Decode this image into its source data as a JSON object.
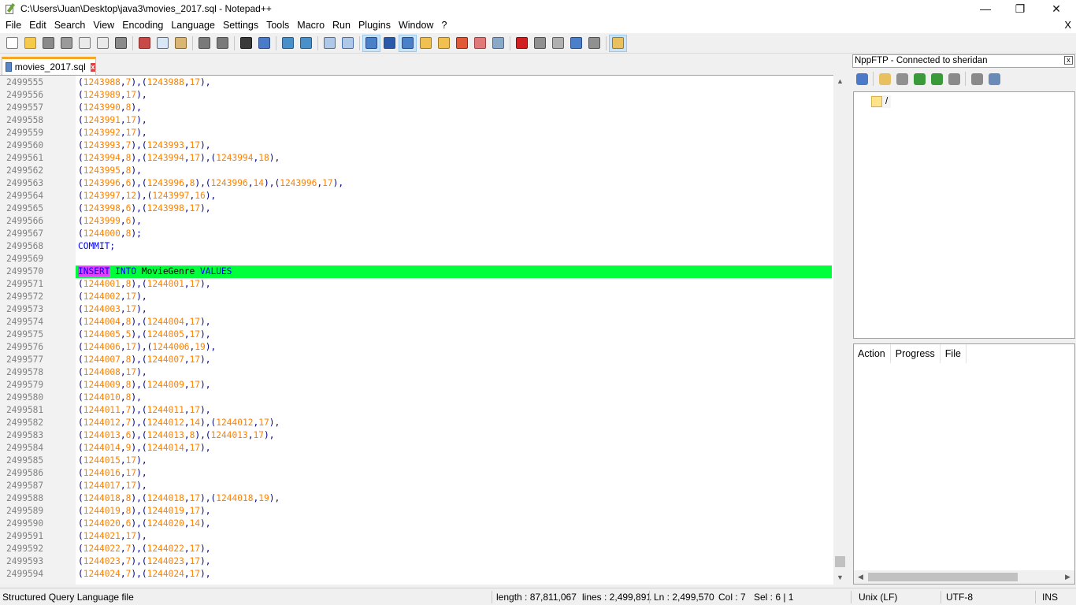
{
  "window": {
    "title": "C:\\Users\\Juan\\Desktop\\java3\\movies_2017.sql - Notepad++",
    "minimize": "—",
    "maximize": "❐",
    "close": "✕"
  },
  "menu": {
    "items": [
      "File",
      "Edit",
      "Search",
      "View",
      "Encoding",
      "Language",
      "Settings",
      "Tools",
      "Macro",
      "Run",
      "Plugins",
      "Window",
      "?"
    ],
    "close_doc": "X"
  },
  "toolbar": {
    "buttons": [
      {
        "name": "new-file-icon",
        "color": "#ffffff",
        "border": "#7a7a7a"
      },
      {
        "name": "open-file-icon",
        "color": "#f6c94a",
        "border": "#b98b1a"
      },
      {
        "name": "save-icon",
        "color": "#8a8a8a",
        "border": "#555555"
      },
      {
        "name": "save-all-icon",
        "color": "#9a9a9a",
        "border": "#555555"
      },
      {
        "name": "close-icon",
        "color": "#eaeaea",
        "border": "#7a7a7a"
      },
      {
        "name": "close-all-icon",
        "color": "#eaeaea",
        "border": "#7a7a7a"
      },
      {
        "name": "print-icon",
        "color": "#8a8a8a",
        "border": "#444444"
      },
      {
        "sep": true
      },
      {
        "name": "cut-icon",
        "color": "#c94848",
        "border": "#8a2c2c"
      },
      {
        "name": "copy-icon",
        "color": "#d8e6f5",
        "border": "#4a6ea8"
      },
      {
        "name": "paste-icon",
        "color": "#d9b674",
        "border": "#8a6a2a"
      },
      {
        "sep": true
      },
      {
        "name": "undo-icon",
        "color": "#7a7a7a",
        "border": "#505050"
      },
      {
        "name": "redo-icon",
        "color": "#7a7a7a",
        "border": "#505050"
      },
      {
        "sep": true
      },
      {
        "name": "find-icon",
        "color": "#3a3a3a",
        "border": "#1a1a1a"
      },
      {
        "name": "replace-icon",
        "color": "#4a7ac8",
        "border": "#2a4a88"
      },
      {
        "sep": true
      },
      {
        "name": "zoom-in-icon",
        "color": "#4a90c8",
        "border": "#2a5a88"
      },
      {
        "name": "zoom-out-icon",
        "color": "#4a90c8",
        "border": "#2a5a88"
      },
      {
        "sep": true
      },
      {
        "name": "sync-vertical-icon",
        "color": "#b0c8e8",
        "border": "#4a6ea8"
      },
      {
        "name": "sync-horizontal-icon",
        "color": "#b0c8e8",
        "border": "#4a6ea8"
      },
      {
        "sep": true
      },
      {
        "name": "word-wrap-icon",
        "color": "#4a80c8",
        "border": "#2a4a88",
        "active": true
      },
      {
        "name": "show-all-chars-icon",
        "color": "#2a5aa8",
        "border": "#2a4a88"
      },
      {
        "name": "indent-guide-icon",
        "color": "#4a80c8",
        "border": "#2a4a88",
        "active": true
      },
      {
        "name": "user-language-icon",
        "color": "#f0c050",
        "border": "#a07820"
      },
      {
        "name": "document-map-icon",
        "color": "#f0c050",
        "border": "#a07820"
      },
      {
        "name": "function-list-icon",
        "color": "#e05a3a",
        "border": "#902a1a"
      },
      {
        "name": "folder-as-workspace-icon",
        "color": "#e07a7a",
        "border": "#a04040"
      },
      {
        "name": "monitoring-icon",
        "color": "#8aa8c8",
        "border": "#4a6a88"
      },
      {
        "sep": true
      },
      {
        "name": "record-macro-icon",
        "color": "#d02020",
        "border": "#801010"
      },
      {
        "name": "stop-macro-icon",
        "color": "#909090",
        "border": "#505050"
      },
      {
        "name": "play-macro-icon",
        "color": "#b0b0b0",
        "border": "#606060"
      },
      {
        "name": "run-macro-multiple-icon",
        "color": "#4a80c8",
        "border": "#2a4a88"
      },
      {
        "name": "save-macro-icon",
        "color": "#909090",
        "border": "#505050"
      },
      {
        "sep": true
      },
      {
        "name": "nppftp-icon",
        "color": "#e8c060",
        "border": "#a07820",
        "active": true
      }
    ]
  },
  "tab": {
    "label": "movies_2017.sql",
    "close": "x"
  },
  "editor": {
    "current_line": "2499570",
    "lines": [
      {
        "n": "2499555",
        "code": "(1243988,7),(1243988,17),"
      },
      {
        "n": "2499556",
        "code": "(1243989,17),"
      },
      {
        "n": "2499557",
        "code": "(1243990,8),"
      },
      {
        "n": "2499558",
        "code": "(1243991,17),"
      },
      {
        "n": "2499559",
        "code": "(1243992,17),"
      },
      {
        "n": "2499560",
        "code": "(1243993,7),(1243993,17),"
      },
      {
        "n": "2499561",
        "code": "(1243994,8),(1243994,17),(1243994,18),"
      },
      {
        "n": "2499562",
        "code": "(1243995,8),"
      },
      {
        "n": "2499563",
        "code": "(1243996,6),(1243996,8),(1243996,14),(1243996,17),"
      },
      {
        "n": "2499564",
        "code": "(1243997,12),(1243997,16),"
      },
      {
        "n": "2499565",
        "code": "(1243998,6),(1243998,17),"
      },
      {
        "n": "2499566",
        "code": "(1243999,6),"
      },
      {
        "n": "2499567",
        "code": "(1244000,8);"
      },
      {
        "n": "2499568",
        "code": "COMMIT;"
      },
      {
        "n": "2499569",
        "code": ""
      },
      {
        "n": "2499570",
        "code": "INSERT INTO MovieGenre VALUES"
      },
      {
        "n": "2499571",
        "code": "(1244001,8),(1244001,17),"
      },
      {
        "n": "2499572",
        "code": "(1244002,17),"
      },
      {
        "n": "2499573",
        "code": "(1244003,17),"
      },
      {
        "n": "2499574",
        "code": "(1244004,8),(1244004,17),"
      },
      {
        "n": "2499575",
        "code": "(1244005,5),(1244005,17),"
      },
      {
        "n": "2499576",
        "code": "(1244006,17),(1244006,19),"
      },
      {
        "n": "2499577",
        "code": "(1244007,8),(1244007,17),"
      },
      {
        "n": "2499578",
        "code": "(1244008,17),"
      },
      {
        "n": "2499579",
        "code": "(1244009,8),(1244009,17),"
      },
      {
        "n": "2499580",
        "code": "(1244010,8),"
      },
      {
        "n": "2499581",
        "code": "(1244011,7),(1244011,17),"
      },
      {
        "n": "2499582",
        "code": "(1244012,7),(1244012,14),(1244012,17),"
      },
      {
        "n": "2499583",
        "code": "(1244013,6),(1244013,8),(1244013,17),"
      },
      {
        "n": "2499584",
        "code": "(1244014,9),(1244014,17),"
      },
      {
        "n": "2499585",
        "code": "(1244015,17),"
      },
      {
        "n": "2499586",
        "code": "(1244016,17),"
      },
      {
        "n": "2499587",
        "code": "(1244017,17),"
      },
      {
        "n": "2499588",
        "code": "(1244018,8),(1244018,17),(1244018,19),"
      },
      {
        "n": "2499589",
        "code": "(1244019,8),(1244019,17),"
      },
      {
        "n": "2499590",
        "code": "(1244020,6),(1244020,14),"
      },
      {
        "n": "2499591",
        "code": "(1244021,17),"
      },
      {
        "n": "2499592",
        "code": "(1244022,7),(1244022,17),"
      },
      {
        "n": "2499593",
        "code": "(1244023,7),(1244023,17),"
      },
      {
        "n": "2499594",
        "code": "(1244024,7),(1244024,17),"
      }
    ]
  },
  "ftp": {
    "title": "NppFTP - Connected to sheridan",
    "close": "x",
    "toolbar": [
      {
        "name": "connect-icon",
        "color": "#4a7ac8"
      },
      {
        "sep": true
      },
      {
        "name": "open-directory-icon",
        "color": "#e8c060"
      },
      {
        "name": "download-icon",
        "color": "#909090"
      },
      {
        "name": "upload-icon",
        "color": "#3a9a3a"
      },
      {
        "name": "refresh-icon",
        "color": "#3a9a3a"
      },
      {
        "name": "abort-icon",
        "color": "#8a8a8a"
      },
      {
        "sep": true
      },
      {
        "name": "settings-icon",
        "color": "#8a8a8a"
      },
      {
        "name": "message-window-icon",
        "color": "#6a8ab8"
      }
    ],
    "tree_root": "/",
    "queue_columns": [
      "Action",
      "Progress",
      "File"
    ]
  },
  "status": {
    "language": "Structured Query Language file",
    "length": "length : 87,811,067",
    "lines": "lines : 2,499,891",
    "position": "Ln : 2,499,570",
    "col": "Col : 7",
    "sel": "Sel : 6 | 1",
    "eol": "Unix (LF)",
    "encoding": "UTF-8",
    "mode": "INS"
  }
}
